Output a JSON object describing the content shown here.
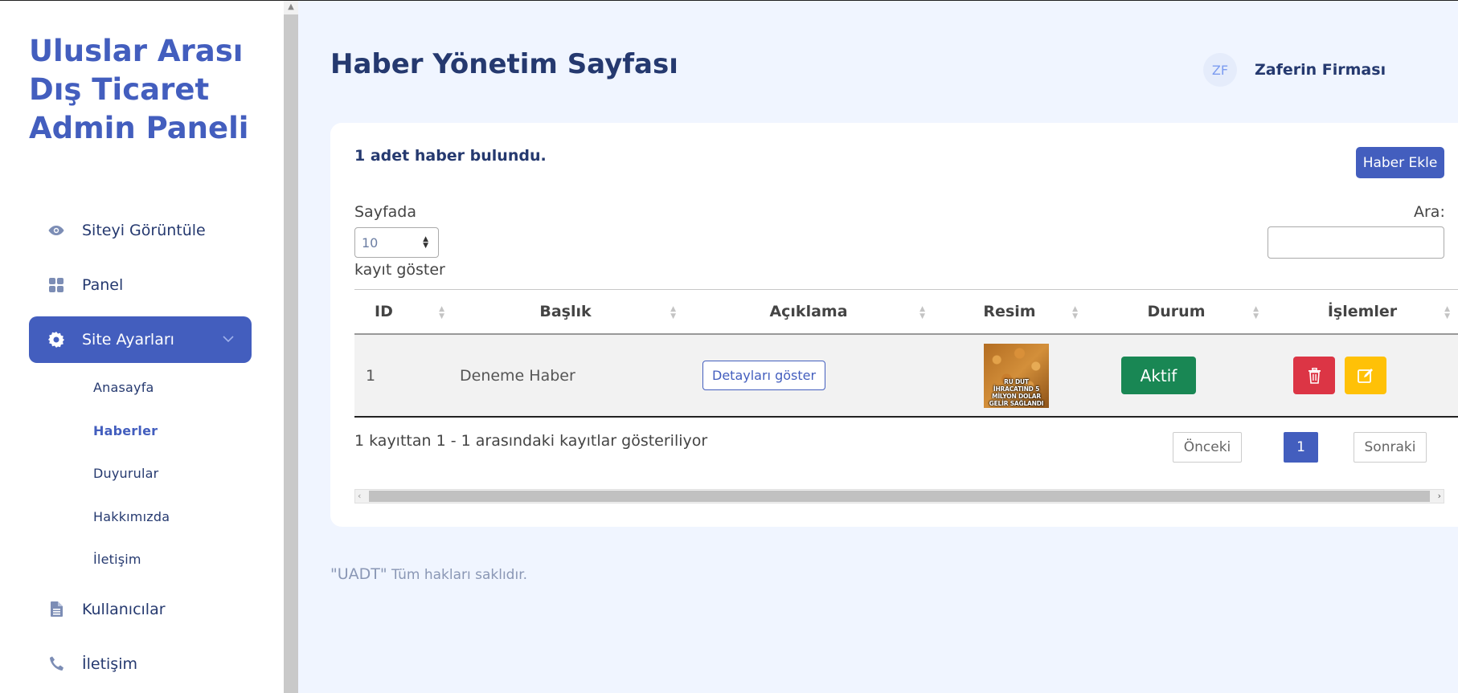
{
  "sidebar": {
    "brand": "Uluslar Arası Dış Ticaret Admin Paneli",
    "items": [
      {
        "label": "Siteyi Görüntüle",
        "icon": "eye-icon"
      },
      {
        "label": "Panel",
        "icon": "grid-icon"
      },
      {
        "label": "Site Ayarları",
        "icon": "gear-icon",
        "active": true
      },
      {
        "label": "Kullanıcılar",
        "icon": "document-icon"
      },
      {
        "label": "İletişim",
        "icon": "phone-icon"
      }
    ],
    "submenu": [
      {
        "label": "Anasayfa"
      },
      {
        "label": "Haberler",
        "current": true
      },
      {
        "label": "Duyurular"
      },
      {
        "label": "Hakkımızda"
      },
      {
        "label": "İletişim"
      }
    ]
  },
  "header": {
    "title": "Haber Yönetim Sayfası",
    "avatar_initials": "ZF",
    "user_name": "Zaferin Firması"
  },
  "card": {
    "found_text": "1 adet haber bulundu.",
    "add_button": "Haber Ekle",
    "length_label": "Sayfada",
    "length_value": "10",
    "length_suffix": "kayıt göster",
    "search_label": "Ara:",
    "search_value": ""
  },
  "table": {
    "columns": [
      "ID",
      "Başlık",
      "Açıklama",
      "Resim",
      "Durum",
      "İşlemler"
    ],
    "rows": [
      {
        "id": "1",
        "title": "Deneme Haber",
        "desc_button": "Detayları göster",
        "image_text": "RU DUT İHRACATIND 5 MİLYON DOLAR GELİR SAĞLANDI",
        "status": "Aktif"
      }
    ]
  },
  "pagination": {
    "info": "1 kayıttan 1 - 1 arasındaki kayıtlar gösteriliyor",
    "prev": "Önceki",
    "current": "1",
    "next": "Sonraki"
  },
  "footer": {
    "brand": "\"UADT\"",
    "text": "Tüm hakları saklıdır."
  },
  "colors": {
    "primary": "#435ebe",
    "text": "#25396f",
    "background": "#f0f5ff",
    "success": "#198754",
    "danger": "#dc3545",
    "warning": "#ffc107"
  }
}
